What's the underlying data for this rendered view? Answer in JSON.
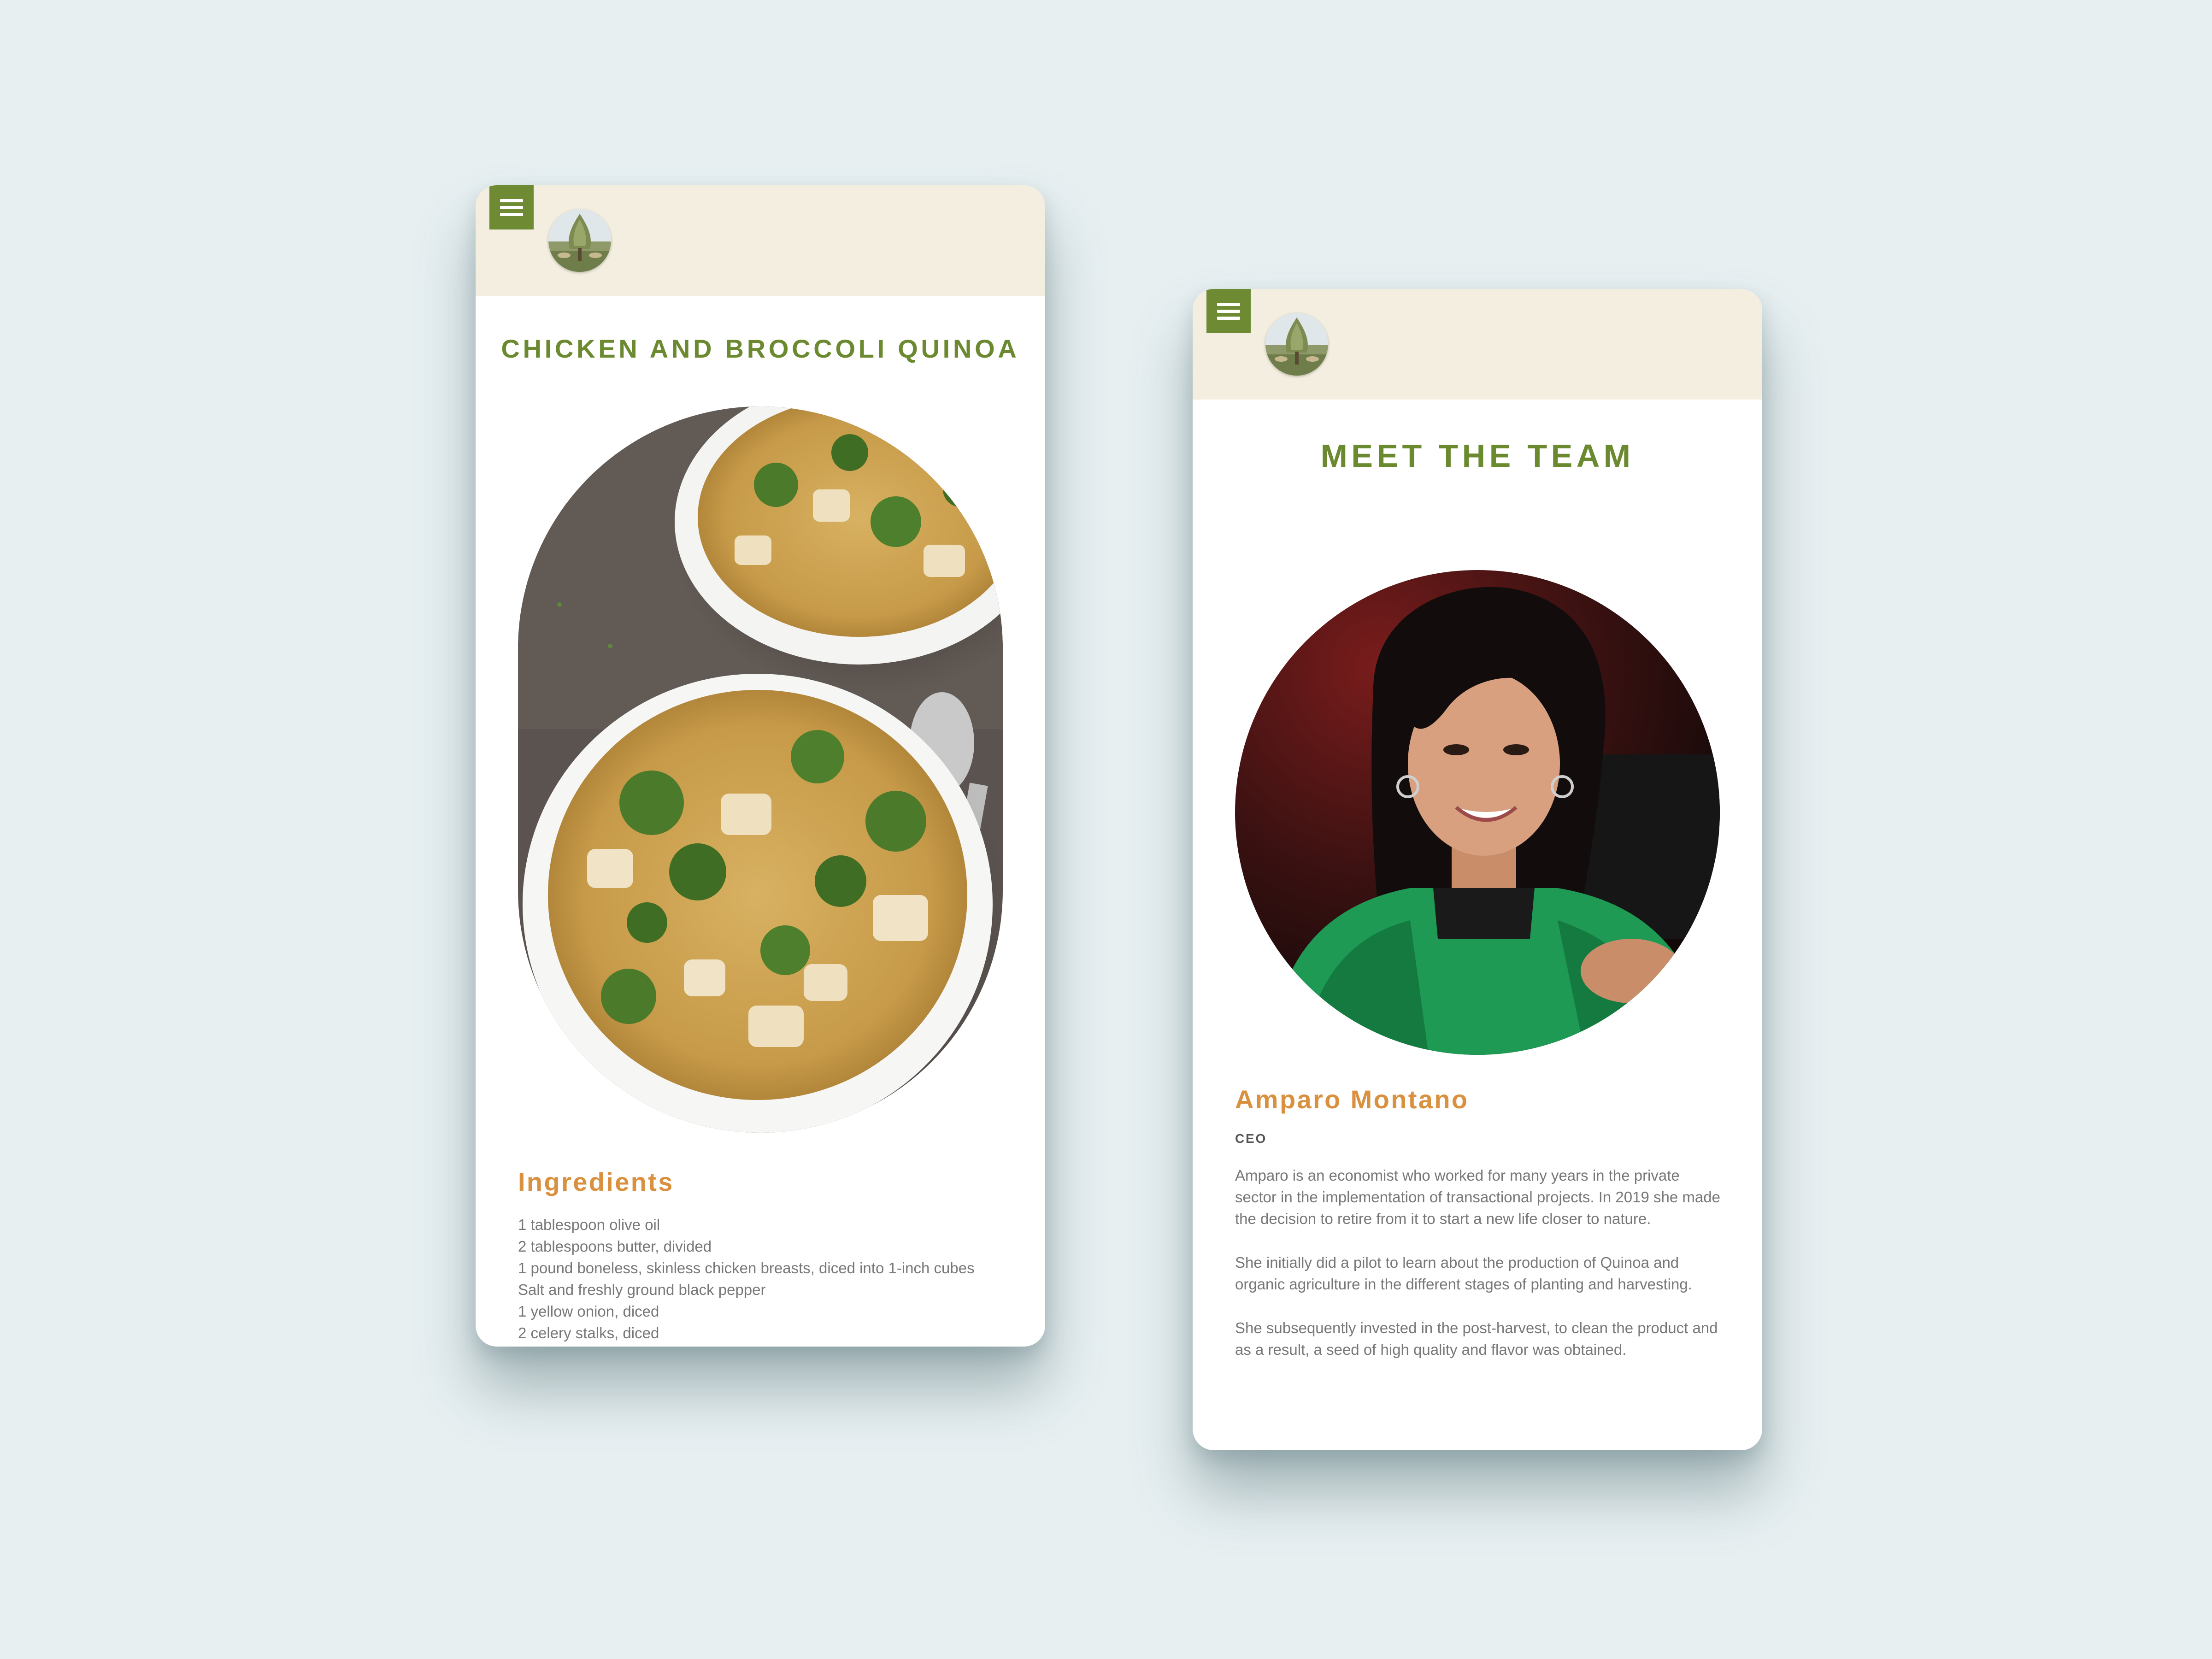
{
  "recipe_screen": {
    "title": "CHICKEN AND BROCCOLI QUINOA",
    "ingredients_heading": "Ingredients",
    "ingredients": [
      "1 tablespoon olive oil",
      "2 tablespoons butter, divided",
      "1 pound boneless, skinless chicken breasts, diced into 1-inch cubes",
      "Salt and freshly ground black pepper",
      "1 yellow onion, diced",
      "2 celery stalks, diced"
    ]
  },
  "team_screen": {
    "title": "MEET THE TEAM",
    "member": {
      "name": "Amparo Montano",
      "role": "CEO",
      "bio": [
        "Amparo is an economist who worked for many years in the private sector in the implementation of transactional projects. In 2019 she made the decision to retire from it to start a new life closer to nature.",
        "She initially did a pilot to learn about the production of Quinoa and organic agriculture in the different stages of planting and harvesting.",
        "She subsequently invested in the post-harvest, to clean the product and as a result, a seed of high quality and flavor was obtained."
      ]
    }
  },
  "icons": {
    "menu": "hamburger-menu-icon",
    "logo": "quinoa-plant-logo"
  },
  "colors": {
    "background": "#e7eff1",
    "header": "#f3eedf",
    "accent_green": "#6e8b34",
    "title_green": "#6b8a30",
    "accent_orange": "#d9903f",
    "body_text": "#777777"
  }
}
